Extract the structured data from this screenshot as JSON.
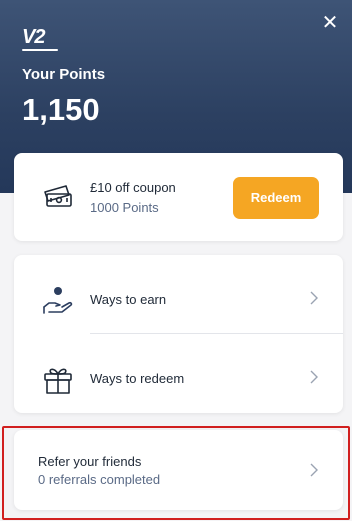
{
  "header": {
    "logo_text": "V2",
    "close_icon": "close-icon",
    "points_label": "Your Points",
    "points_value": "1,150"
  },
  "coupon": {
    "icon": "ticket-icon",
    "title": "£10 off coupon",
    "points": "1000 Points",
    "button_label": "Redeem",
    "button_color": "#f5a623"
  },
  "menu": {
    "items": [
      {
        "label": "Ways to earn",
        "icon": "hand-coin-icon"
      },
      {
        "label": "Ways to redeem",
        "icon": "gift-icon"
      }
    ]
  },
  "refer": {
    "title": "Refer your friends",
    "subtitle": "0 referrals completed",
    "highlight_color": "#d11f1f"
  },
  "colors": {
    "header_bg": "#2c4061",
    "accent": "#f5a623",
    "subtext": "#5a6a86"
  }
}
